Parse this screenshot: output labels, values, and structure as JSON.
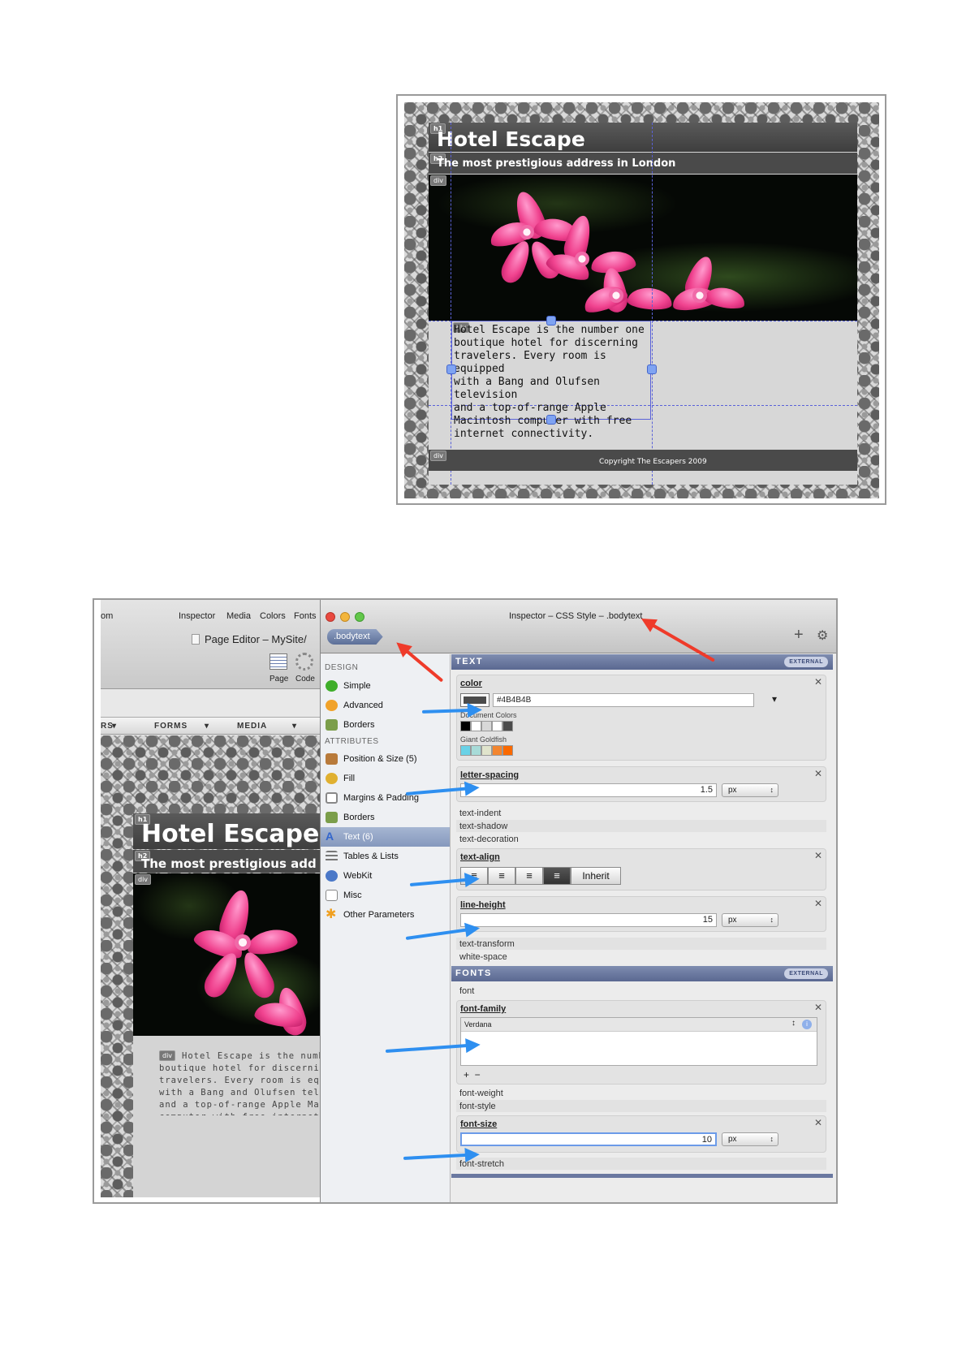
{
  "top_shot": {
    "h1_tag": "h1",
    "h1_title": "Hotel Escape",
    "h2_tag": "h2",
    "h2_text": "The most prestigious address in London",
    "div_tag": "div",
    "body_text": "Hotel Escape is the number one\nboutique hotel for discerning\ntravelers. Every room is equipped\nwith a Bang and Olufsen television\nand a top-of-range Apple\nMacintosh computer with free\ninternet connectivity.",
    "footer_tag": "div",
    "footer_text": "Copyright The Escapers 2009"
  },
  "bottom_shot": {
    "left_pane": {
      "toolbar_items": [
        "om",
        "Inspector",
        "Media",
        "Colors",
        "Fonts"
      ],
      "window_title": "Page Editor – MySite/",
      "page_label": "Page",
      "code_label": "Code",
      "tabs": [
        "RS",
        "FORMS",
        "MEDIA"
      ],
      "h1_title": "Hotel Escape",
      "h2_text": "The most prestigious add",
      "body_text": "Hotel Escape is the number one boutique hotel for discerning travelers. Every room is equipped with a Bang and Olufsen television and a top-of-range Apple Macintosh computer with free internet connectivity."
    },
    "inspector": {
      "window_title": "Inspector – CSS Style – .bodytext",
      "selector": ".bodytext",
      "categories_design_heading": "DESIGN",
      "categories_attributes_heading": "ATTRIBUTES",
      "categories": [
        {
          "label": "Simple",
          "icon": "green-circle-icon",
          "color": "#3fae2a"
        },
        {
          "label": "Advanced",
          "icon": "orange-circle-icon",
          "color": "#f1a22a"
        },
        {
          "label": "Borders",
          "icon": "borders-icon",
          "color": "#7b9e4a"
        },
        {
          "label": "Position & Size (5)",
          "icon": "position-icon",
          "color": "#b87a3a"
        },
        {
          "label": "Fill",
          "icon": "fill-icon",
          "color": "#e0b030"
        },
        {
          "label": "Margins & Padding",
          "icon": "margins-icon",
          "color": "#888888"
        },
        {
          "label": "Borders",
          "icon": "borders-icon",
          "color": "#7b9e4a"
        },
        {
          "label": "Text (6)",
          "icon": "text-icon",
          "color": "#3366cc"
        },
        {
          "label": "Tables & Lists",
          "icon": "list-icon",
          "color": "#777777"
        },
        {
          "label": "WebKit",
          "icon": "webkit-icon",
          "color": "#4a78c8"
        },
        {
          "label": "Misc",
          "icon": "misc-icon",
          "color": "#888888"
        },
        {
          "label": "Other Parameters",
          "icon": "asterisk-icon",
          "color": "#f0a020"
        }
      ],
      "text_section": "TEXT",
      "fonts_section": "FONTS",
      "external_badge": "EXTERNAL",
      "color_label": "color",
      "color_value": "#4B4B4B",
      "document_colors_label": "Document Colors",
      "document_colors": [
        "#000000",
        "#ffffff",
        "#d8d8d8",
        "#ffffff",
        "#4b4b4b"
      ],
      "palette_label": "Giant Goldfish",
      "palette_colors": [
        "#69d2e7",
        "#a7dbd8",
        "#e0e4cc",
        "#f38630",
        "#fa6900"
      ],
      "letter_spacing_label": "letter-spacing",
      "letter_spacing_value": "1.5",
      "letter_spacing_unit": "px",
      "text_indent_label": "text-indent",
      "text_shadow_label": "text-shadow",
      "text_decoration_label": "text-decoration",
      "text_align_label": "text-align",
      "inherit_label": "Inherit",
      "line_height_label": "line-height",
      "line_height_value": "15",
      "line_height_unit": "px",
      "text_transform_label": "text-transform",
      "white_space_label": "white-space",
      "font_label": "font",
      "font_family_label": "font-family",
      "font_family_value": "Verdana",
      "add_remove": "+  −",
      "font_weight_label": "font-weight",
      "font_style_label": "font-style",
      "font_size_label": "font-size",
      "font_size_value": "10",
      "font_size_unit": "px",
      "font_stretch_label": "font-stretch"
    }
  }
}
